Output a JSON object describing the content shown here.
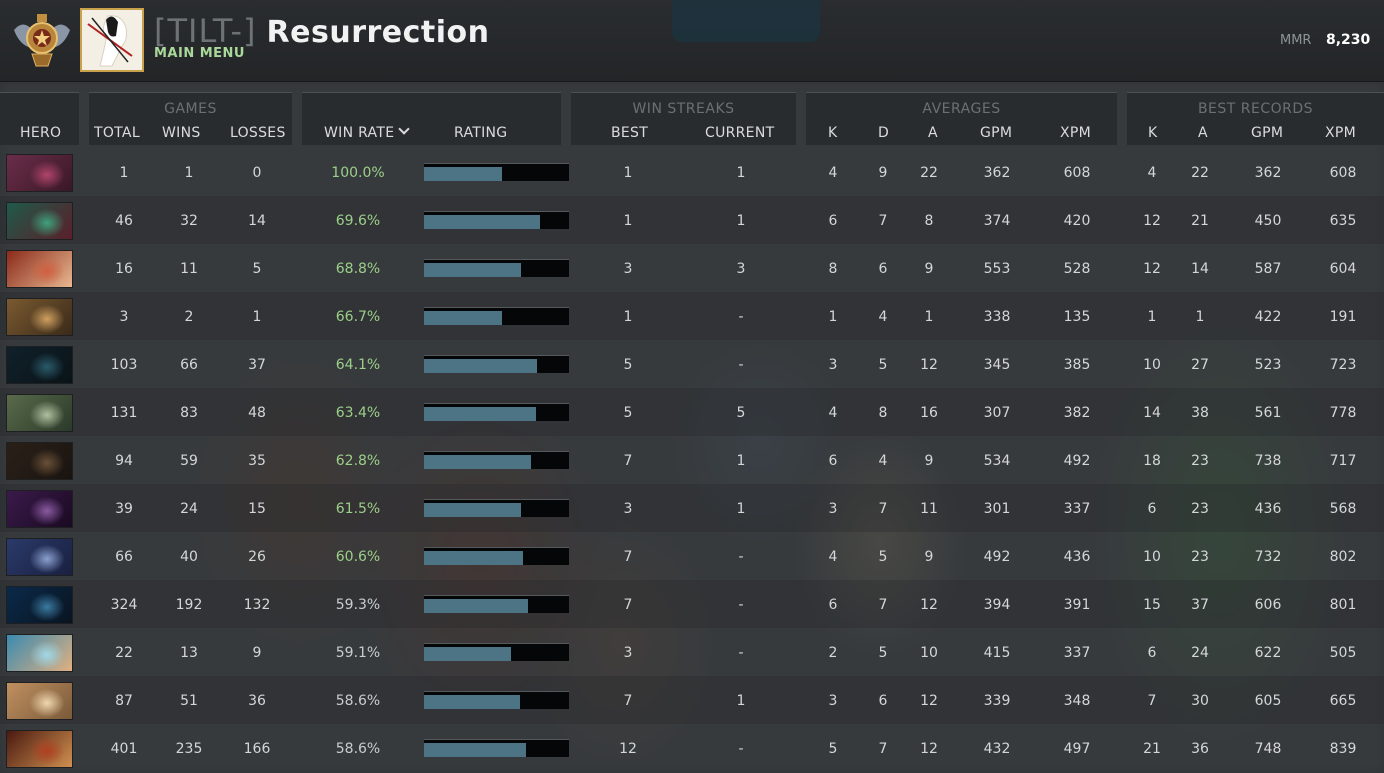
{
  "header": {
    "clan_tag": "[TILT-]",
    "player_name": "Resurrection",
    "main_menu": "MAIN MENU",
    "mmr_label": "MMR",
    "mmr_value": "8,230"
  },
  "columns": {
    "hero": "HERO",
    "games": {
      "title": "GAMES",
      "total": "TOTAL",
      "wins": "WINS",
      "losses": "LOSSES"
    },
    "win_rate": "WIN RATE",
    "rating": "RATING",
    "win_streaks": {
      "title": "WIN STREAKS",
      "best": "BEST",
      "current": "CURRENT"
    },
    "averages": {
      "title": "AVERAGES",
      "k": "K",
      "d": "D",
      "a": "A",
      "gpm": "GPM",
      "xpm": "XPM"
    },
    "best_records": {
      "title": "BEST RECORDS",
      "k": "K",
      "a": "A",
      "gpm": "GPM",
      "xpm": "XPM"
    }
  },
  "colors": {
    "win_rate_green": "#9bcf88",
    "rating_fill": "#4d7485",
    "avatar_border": "#c9a14a"
  },
  "rows": [
    {
      "portrait": [
        "#6a2d4a",
        "#b0456a",
        "#3a1826"
      ],
      "total": "1",
      "wins": "1",
      "losses": "0",
      "win_rate": "100.0%",
      "rating": 0.54,
      "streak_best": "1",
      "streak_current": "1",
      "avg_k": "4",
      "avg_d": "9",
      "avg_a": "22",
      "avg_gpm": "362",
      "avg_xpm": "608",
      "best_k": "4",
      "best_a": "22",
      "best_gpm": "362",
      "best_xpm": "608"
    },
    {
      "portrait": [
        "#1f5a4a",
        "#3fa27c",
        "#5a1f2a"
      ],
      "total": "46",
      "wins": "32",
      "losses": "14",
      "win_rate": "69.6%",
      "rating": 0.8,
      "streak_best": "1",
      "streak_current": "1",
      "avg_k": "6",
      "avg_d": "7",
      "avg_a": "8",
      "avg_gpm": "374",
      "avg_xpm": "420",
      "best_k": "12",
      "best_a": "21",
      "best_gpm": "450",
      "best_xpm": "635"
    },
    {
      "portrait": [
        "#8a2a1a",
        "#d06040",
        "#e8b890"
      ],
      "total": "16",
      "wins": "11",
      "losses": "5",
      "win_rate": "68.8%",
      "rating": 0.67,
      "streak_best": "3",
      "streak_current": "3",
      "avg_k": "8",
      "avg_d": "6",
      "avg_a": "9",
      "avg_gpm": "553",
      "avg_xpm": "528",
      "best_k": "12",
      "best_a": "14",
      "best_gpm": "587",
      "best_xpm": "604"
    },
    {
      "portrait": [
        "#7a5a30",
        "#d0a060",
        "#3a2a1a"
      ],
      "total": "3",
      "wins": "2",
      "losses": "1",
      "win_rate": "66.7%",
      "rating": 0.54,
      "streak_best": "1",
      "streak_current": "-",
      "avg_k": "1",
      "avg_d": "4",
      "avg_a": "1",
      "avg_gpm": "338",
      "avg_xpm": "135",
      "best_k": "1",
      "best_a": "1",
      "best_gpm": "422",
      "best_xpm": "191"
    },
    {
      "portrait": [
        "#10202a",
        "#2a5a6a",
        "#0a1418"
      ],
      "total": "103",
      "wins": "66",
      "losses": "37",
      "win_rate": "64.1%",
      "rating": 0.78,
      "streak_best": "5",
      "streak_current": "-",
      "avg_k": "3",
      "avg_d": "5",
      "avg_a": "12",
      "avg_gpm": "345",
      "avg_xpm": "385",
      "best_k": "10",
      "best_a": "27",
      "best_gpm": "523",
      "best_xpm": "723"
    },
    {
      "portrait": [
        "#5a6a4a",
        "#b0c0a0",
        "#2a3a2a"
      ],
      "total": "131",
      "wins": "83",
      "losses": "48",
      "win_rate": "63.4%",
      "rating": 0.77,
      "streak_best": "5",
      "streak_current": "5",
      "avg_k": "4",
      "avg_d": "8",
      "avg_a": "16",
      "avg_gpm": "307",
      "avg_xpm": "382",
      "best_k": "14",
      "best_a": "38",
      "best_gpm": "561",
      "best_xpm": "778"
    },
    {
      "portrait": [
        "#2a2018",
        "#6a5038",
        "#1a1410"
      ],
      "total": "94",
      "wins": "59",
      "losses": "35",
      "win_rate": "62.8%",
      "rating": 0.74,
      "streak_best": "7",
      "streak_current": "1",
      "avg_k": "6",
      "avg_d": "4",
      "avg_a": "9",
      "avg_gpm": "534",
      "avg_xpm": "492",
      "best_k": "18",
      "best_a": "23",
      "best_gpm": "738",
      "best_xpm": "717"
    },
    {
      "portrait": [
        "#3a1a4a",
        "#8a5aa0",
        "#1a0a22"
      ],
      "total": "39",
      "wins": "24",
      "losses": "15",
      "win_rate": "61.5%",
      "rating": 0.67,
      "streak_best": "3",
      "streak_current": "1",
      "avg_k": "3",
      "avg_d": "7",
      "avg_a": "11",
      "avg_gpm": "301",
      "avg_xpm": "337",
      "best_k": "6",
      "best_a": "23",
      "best_gpm": "436",
      "best_xpm": "568"
    },
    {
      "portrait": [
        "#2a3a6a",
        "#8aa0d0",
        "#1a2040"
      ],
      "total": "66",
      "wins": "40",
      "losses": "26",
      "win_rate": "60.6%",
      "rating": 0.68,
      "streak_best": "7",
      "streak_current": "-",
      "avg_k": "4",
      "avg_d": "5",
      "avg_a": "9",
      "avg_gpm": "492",
      "avg_xpm": "436",
      "best_k": "10",
      "best_a": "23",
      "best_gpm": "732",
      "best_xpm": "802"
    },
    {
      "portrait": [
        "#0a2a4a",
        "#3a7aa0",
        "#0a1420"
      ],
      "total": "324",
      "wins": "192",
      "losses": "132",
      "win_rate": "59.3%",
      "rating": 0.72,
      "streak_best": "7",
      "streak_current": "-",
      "avg_k": "6",
      "avg_d": "7",
      "avg_a": "12",
      "avg_gpm": "394",
      "avg_xpm": "391",
      "best_k": "15",
      "best_a": "37",
      "best_gpm": "606",
      "best_xpm": "801"
    },
    {
      "portrait": [
        "#3a8ab0",
        "#a0d8e8",
        "#e0b080"
      ],
      "total": "22",
      "wins": "13",
      "losses": "9",
      "win_rate": "59.1%",
      "rating": 0.6,
      "streak_best": "3",
      "streak_current": "-",
      "avg_k": "2",
      "avg_d": "5",
      "avg_a": "10",
      "avg_gpm": "415",
      "avg_xpm": "337",
      "best_k": "6",
      "best_a": "24",
      "best_gpm": "622",
      "best_xpm": "505"
    },
    {
      "portrait": [
        "#c09060",
        "#f0d8b0",
        "#7a5a3a"
      ],
      "total": "87",
      "wins": "51",
      "losses": "36",
      "win_rate": "58.6%",
      "rating": 0.66,
      "streak_best": "7",
      "streak_current": "1",
      "avg_k": "3",
      "avg_d": "6",
      "avg_a": "12",
      "avg_gpm": "339",
      "avg_xpm": "348",
      "best_k": "7",
      "best_a": "30",
      "best_gpm": "605",
      "best_xpm": "665"
    },
    {
      "portrait": [
        "#4a1a10",
        "#b04020",
        "#d09050"
      ],
      "total": "401",
      "wins": "235",
      "losses": "166",
      "win_rate": "58.6%",
      "rating": 0.7,
      "streak_best": "12",
      "streak_current": "-",
      "avg_k": "5",
      "avg_d": "7",
      "avg_a": "12",
      "avg_gpm": "432",
      "avg_xpm": "497",
      "best_k": "21",
      "best_a": "36",
      "best_gpm": "748",
      "best_xpm": "839"
    }
  ]
}
